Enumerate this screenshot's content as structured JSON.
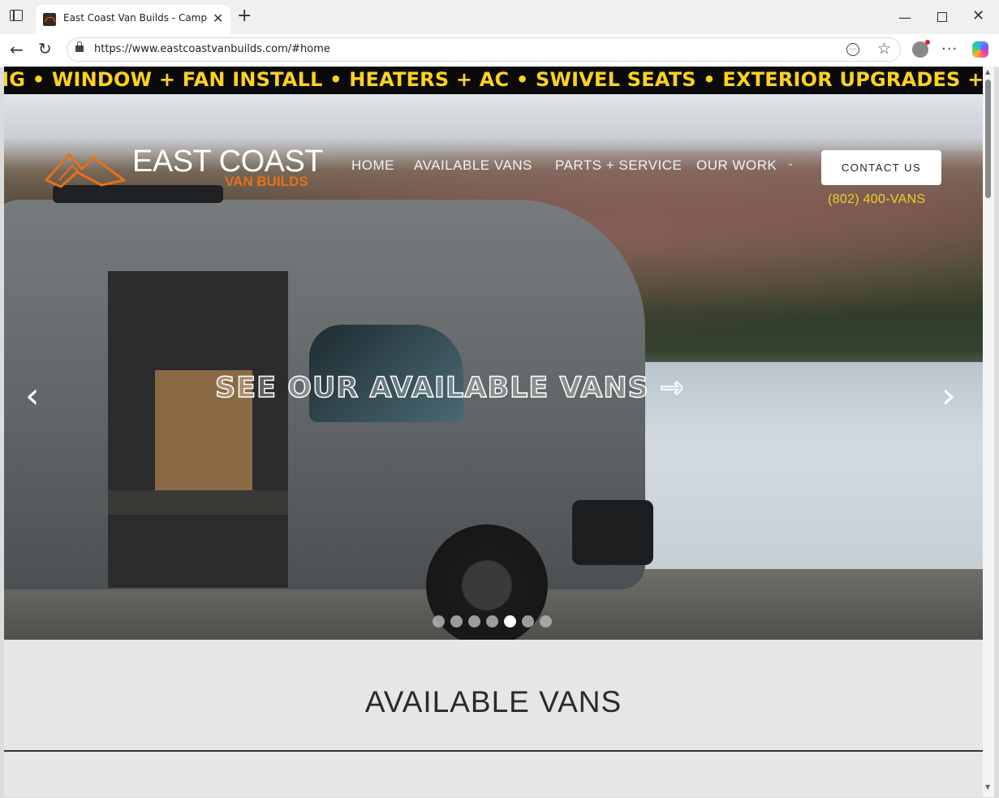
{
  "browser": {
    "tab_title": "East Coast Van Builds - Camper Van",
    "url": "https://www.eastcoastvanbuilds.com/#home",
    "new_tab": "+",
    "close": "✕"
  },
  "ticker": {
    "text": "NG • WINDOW + FAN INSTALL • HEATERS + AC • SWIVEL SEATS • EXTERIOR UPGRADES + MORE •"
  },
  "logo": {
    "main": "EAST COAST",
    "sub": "VAN BUILDS"
  },
  "nav": {
    "items": [
      "HOME",
      "AVAILABLE VANS",
      "PARTS + SERVICE",
      "OUR WORK"
    ],
    "dropdown_glyph": "⌄",
    "contact_label": "CONTACT US",
    "phone": "(802) 400-VANS"
  },
  "hero": {
    "cta": "SEE OUR AVAILABLE VANS →",
    "prev": "‹",
    "next": "›",
    "slide_count": 7,
    "active_slide": 5
  },
  "section": {
    "title": "AVAILABLE VANS"
  },
  "colors": {
    "accent_orange": "#e8711a",
    "ticker_yellow": "#ffd21e",
    "phone_yellow": "#f1cf1e"
  }
}
